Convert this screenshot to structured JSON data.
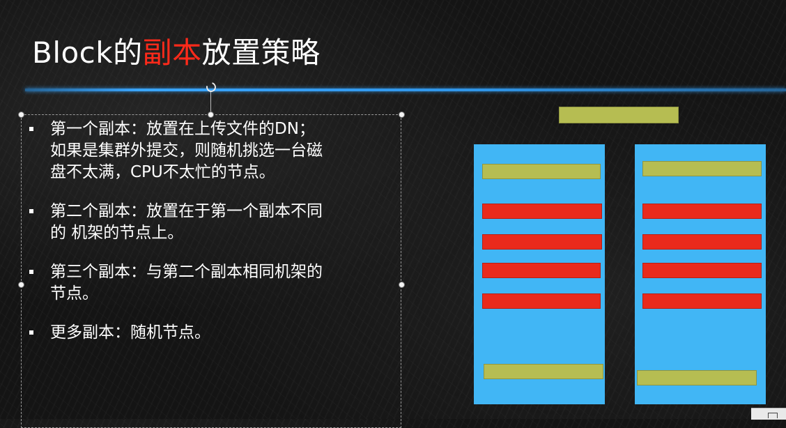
{
  "slide": {
    "title_prefix": "Block的",
    "title_highlight": "副本",
    "title_suffix": "放置策略",
    "highlight_color": "#ff2a1a",
    "rule_color": "#3aa6ff"
  },
  "bullets": [
    {
      "text": "第一个副本：放置在上传文件的DN；\n如果是集群外提交，则随机挑选一台磁\n盘不太满，CPU不太忙的节点。"
    },
    {
      "text": "第二个副本：放置在于第一个副本不同\n的 机架的节点上。"
    },
    {
      "text": "第三个副本：与第二个副本相同机架的\n节点。"
    },
    {
      "text": "更多副本：随机节点。"
    }
  ],
  "diagram": {
    "rack_color": "#41b6f5",
    "block_color": "#b6bd52",
    "node_color": "#e92a1c",
    "racks": [
      {
        "name": "rack-left",
        "node_count": 4,
        "block_slots": 2
      },
      {
        "name": "rack-right",
        "node_count": 4,
        "block_slots": 2
      }
    ],
    "incoming_block_count": 1
  }
}
